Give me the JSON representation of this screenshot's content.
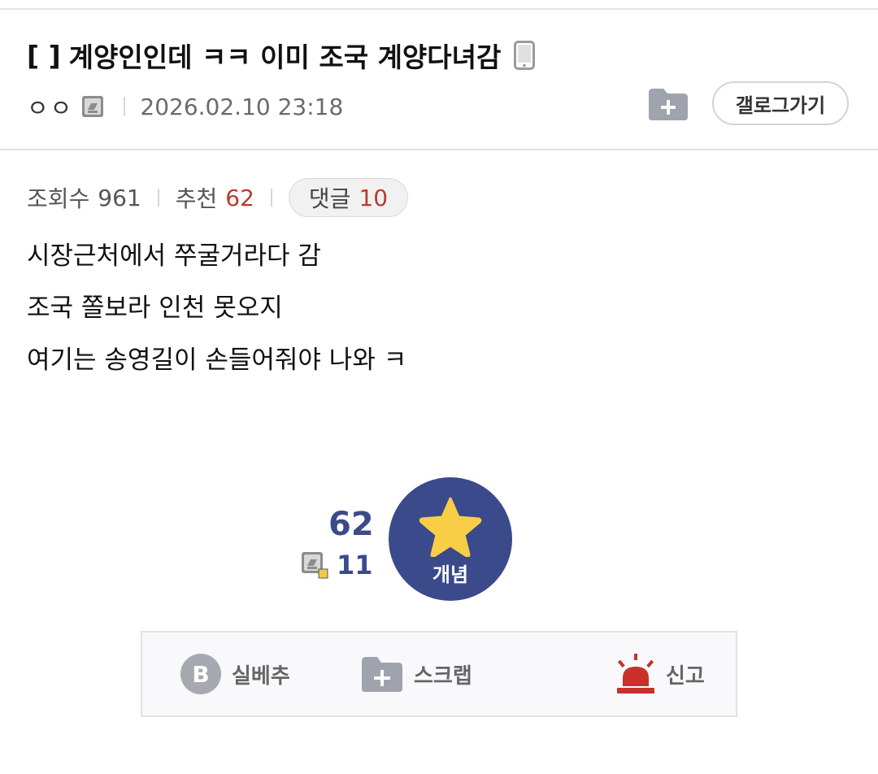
{
  "post": {
    "title_bracket": "[   ]",
    "title": "계양인인데 ㅋㅋ 이미 조국 계양다녀감",
    "author": "ㅇㅇ",
    "date": "2026.02.10 23:18",
    "body": [
      "시장근처에서 쭈굴거라다 감",
      "조국 쫄보라 인천 못오지",
      "여기는 송영길이 손들어줘야 나와 ㅋ"
    ]
  },
  "header": {
    "gallery_button": "갤로그가기"
  },
  "stats": {
    "views_label": "조회수",
    "views": "961",
    "recommend_label": "추천",
    "recommend": "62",
    "comments_label": "댓글",
    "comments": "10"
  },
  "vote": {
    "count": "62",
    "fixed_count": "11",
    "button_label": "개념"
  },
  "actions": {
    "best": "실베추",
    "scrap": "스크랩",
    "report": "신고"
  },
  "colors": {
    "accent": "#3b4a8a",
    "red": "#b83a2e",
    "star": "#f7ce46",
    "report": "#c9302c"
  }
}
